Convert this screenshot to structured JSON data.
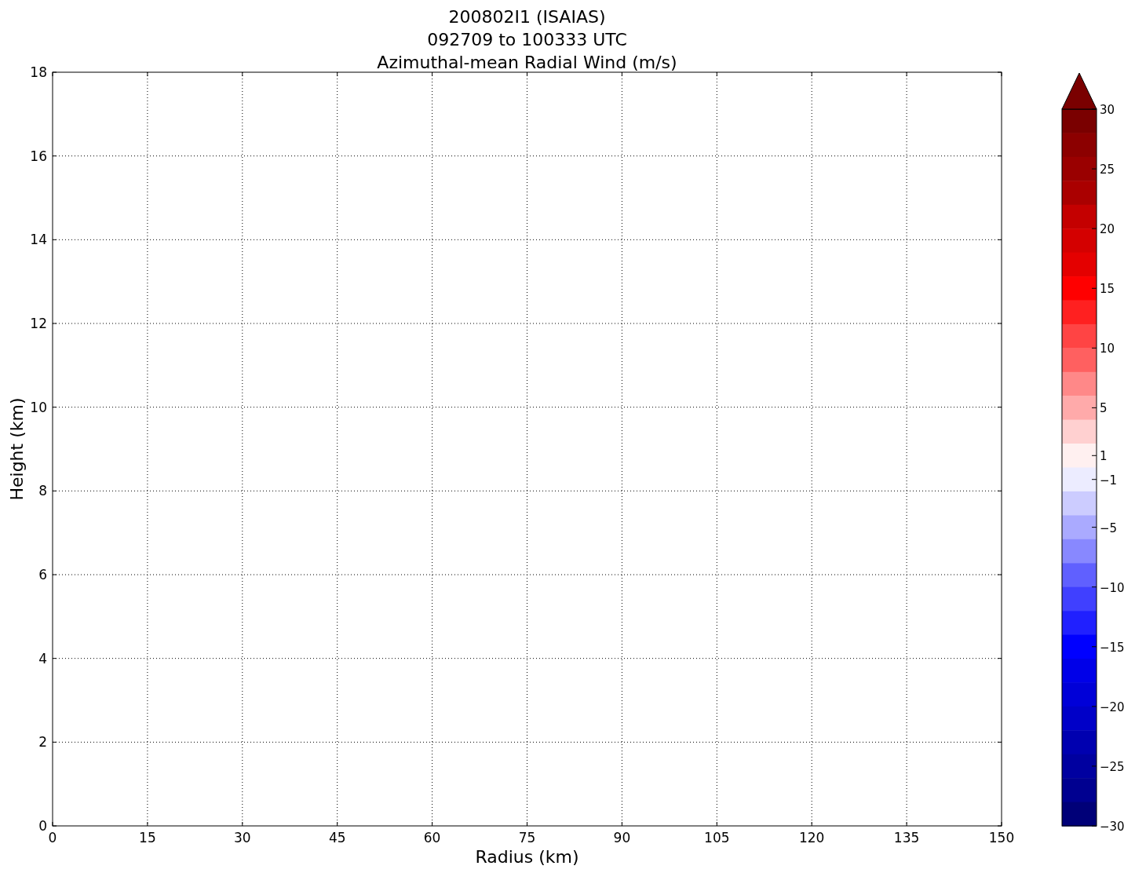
{
  "figure": {
    "title_lines": [
      "200802I1 (ISAIAS)",
      "092709 to 100333 UTC",
      "Azimuthal-mean Radial Wind (m/s)"
    ],
    "chart_data": {
      "type": "heatmap",
      "xlabel": "Radius (km)",
      "ylabel": "Height (km)",
      "xlim": [
        0,
        150
      ],
      "ylim": [
        0,
        18
      ],
      "grid": true,
      "xticks": [
        0,
        15,
        30,
        45,
        60,
        75,
        90,
        105,
        120,
        135,
        150
      ],
      "yticks": [
        0,
        2,
        4,
        6,
        8,
        10,
        12,
        14,
        16,
        18
      ]
    },
    "colorbar": {
      "extend_max": true,
      "bands": [
        {
          "color": "#7a0000"
        },
        {
          "color": "#8c0000"
        },
        {
          "color": "#9a0000"
        },
        {
          "color": "#aa0000"
        },
        {
          "color": "#c40000"
        },
        {
          "color": "#d40000"
        },
        {
          "color": "#e40000"
        },
        {
          "color": "#ff0000"
        },
        {
          "color": "#ff2020"
        },
        {
          "color": "#ff4444"
        },
        {
          "color": "#ff6060"
        },
        {
          "color": "#ff8888"
        },
        {
          "color": "#ffaaaa"
        },
        {
          "color": "#ffd0d0"
        },
        {
          "color": "#fff0f0"
        },
        {
          "color": "#ececff"
        },
        {
          "color": "#ccccff"
        },
        {
          "color": "#aaaaff"
        },
        {
          "color": "#8888ff"
        },
        {
          "color": "#6060ff"
        },
        {
          "color": "#4040ff"
        },
        {
          "color": "#2020ff"
        },
        {
          "color": "#0000ff"
        },
        {
          "color": "#0000e8"
        },
        {
          "color": "#0000d8"
        },
        {
          "color": "#0000c8"
        },
        {
          "color": "#0000b0"
        },
        {
          "color": "#0000a0"
        },
        {
          "color": "#000090"
        },
        {
          "color": "#000078"
        }
      ],
      "ticks": [
        "30",
        "25",
        "20",
        "15",
        "10",
        "5",
        "1",
        "−1",
        "−5",
        "−10",
        "−15",
        "−20",
        "−25",
        "−30"
      ]
    }
  }
}
